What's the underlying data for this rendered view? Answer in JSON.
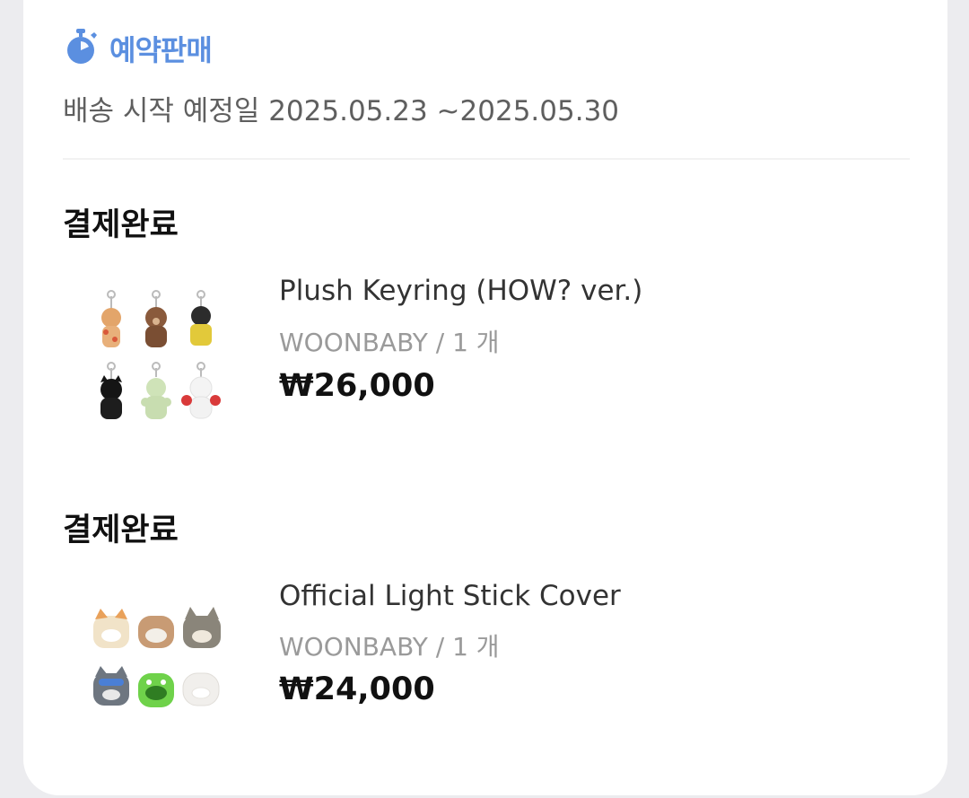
{
  "preorder": {
    "label": "예약판매",
    "icon": "stopwatch-icon",
    "accent": "#5b8fe0"
  },
  "shipping": {
    "text": "배송 시작 예정일 2025.05.23 ~2025.05.30"
  },
  "orders": [
    {
      "status": "결제완료",
      "name": "Plush Keyring (HOW? ver.)",
      "meta": "WOONBABY / 1 개",
      "price": "₩26,000"
    },
    {
      "status": "결제완료",
      "name": "Official Light Stick Cover",
      "meta": "WOONBABY / 1 개",
      "price": "₩24,000"
    }
  ]
}
